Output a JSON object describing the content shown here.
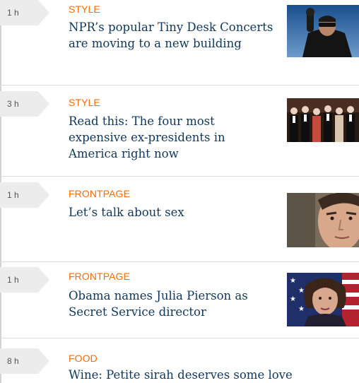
{
  "feed": {
    "items": [
      {
        "time": "1 h",
        "category": "STYLE",
        "headline": "NPR’s popular Tiny Desk Concerts are moving to a new building",
        "thumbnail": "man-raising-fist-photo"
      },
      {
        "time": "3 h",
        "category": "STYLE",
        "headline": "Read this: The four most expensive ex-presidents in America right now",
        "thumbnail": "ex-presidents-group-photo"
      },
      {
        "time": "1 h",
        "category": "FRONTPAGE",
        "headline": "Let’s talk about sex",
        "thumbnail": "man-portrait-photo"
      },
      {
        "time": "1 h",
        "category": "FRONTPAGE",
        "headline": "Obama names Julia Pierson as Secret Service director",
        "thumbnail": "julia-pierson-flag-photo"
      },
      {
        "time": "8 h",
        "category": "FOOD",
        "headline": "Wine: Petite sirah deserves some love"
      }
    ]
  },
  "colors": {
    "category": "#ff6a00",
    "headline": "#10375a",
    "time_tag_bg": "#ececec"
  }
}
